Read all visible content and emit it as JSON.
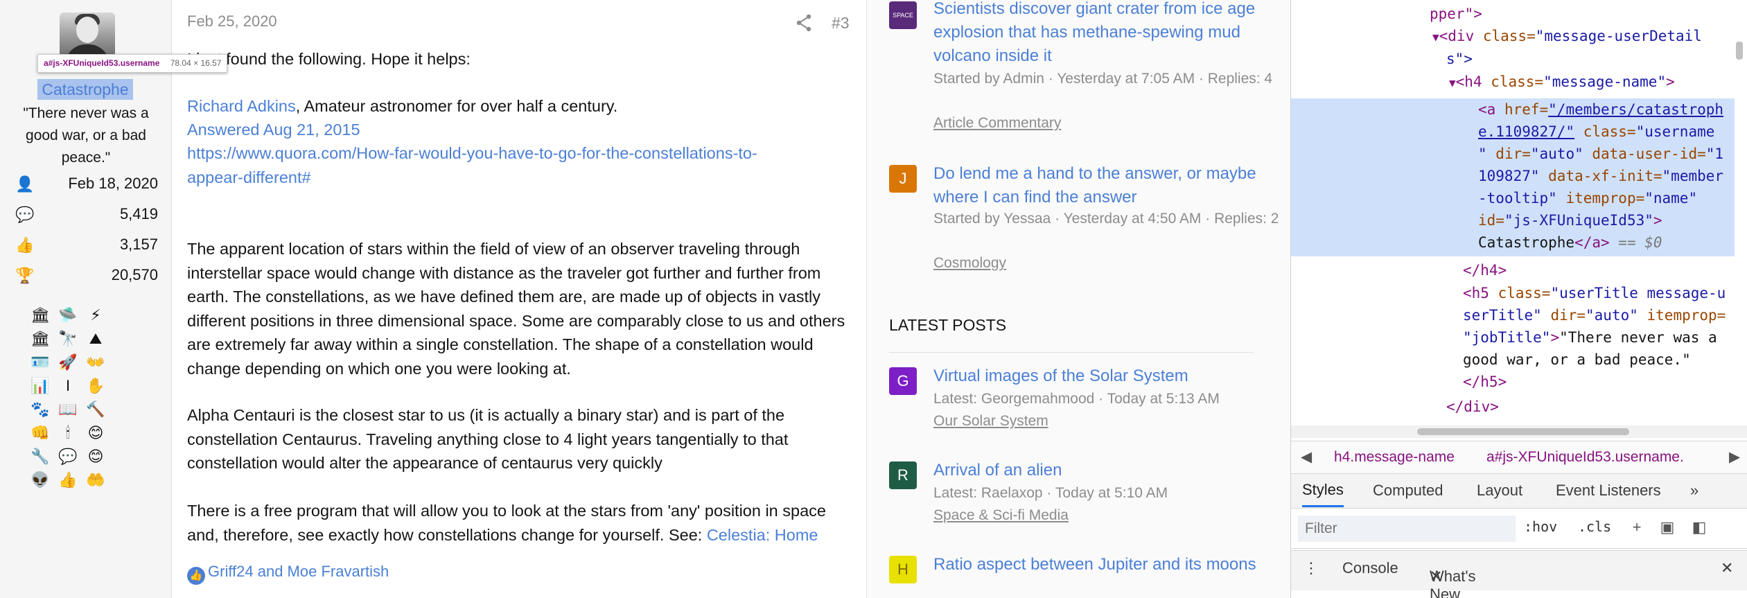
{
  "user": {
    "tooltip_selector": "a#js-XFUniqueId53.username",
    "tooltip_dims": "78.04 × 16.57",
    "username": "Catastrophe",
    "title": "\"There never was a good war, or a bad peace.\"",
    "stats": [
      {
        "icon": "user-icon",
        "glyph": "👤",
        "value": "Feb 18, 2020"
      },
      {
        "icon": "messages-icon",
        "glyph": "💬",
        "value": "5,419"
      },
      {
        "icon": "thumbs-up-icon",
        "glyph": "👍",
        "value": "3,157"
      },
      {
        "icon": "trophy-icon",
        "glyph": "🏆",
        "value": "20,570"
      }
    ],
    "trophies": [
      "🏛",
      "🛸",
      "⚡",
      "🏛",
      "🔭",
      "⛰",
      "🪪",
      "🚀",
      "👐",
      "📊",
      "I",
      "✋",
      "🐾",
      "📖",
      "🔨",
      "👊",
      "🕯",
      "😊",
      "🔧",
      "💬",
      "😊",
      "👽",
      "👍",
      "🤲"
    ]
  },
  "post": {
    "date": "Feb 25, 2020",
    "number": "#3",
    "intro": "I just found the following. Hope it helps:",
    "author_link": "Richard Adkins",
    "author_desc": ", Amateur astronomer for over half a century.",
    "answered": "Answered Aug 21, 2015",
    "url_line1": "https://www.quora.com/How-far-would-you-have-to-go-for-the-constellations-to-",
    "url_line2": "appear-different#",
    "para1": "The apparent location of stars within the field of view of an observer traveling through interstellar space would change with distance as the traveler got further and further from earth. The constellations, as we have defined them are, are made up of objects in vastly different positions in three dimensional space. Some are comparably close to us and others are extremely far away within a single constellation. The shape of a constellation would change depending on which one you were looking at.",
    "para2": "Alpha Centauri is the closest star to us (it is actually a binary star) and is part of the constellation Centaurus. Traveling anything close to 4 light years tangentially to that constellation would alter the appearance of centaurus very quickly",
    "para3": "There is a free program that will allow you to look at the stars from 'any' position in space and, therefore, see exactly how constellations change for yourself. See: ",
    "para3_link": "Celestia: Home",
    "reactions": "Griff24 and Moe Fravartish"
  },
  "widgets": {
    "threads": [
      {
        "avatar": "SPACE",
        "avatar_color": "#5a2a7a",
        "title": "Scientists discover giant crater from ice age explosion that has methane-spewing mud volcano inside it",
        "meta": "Started by Admin · Yesterday at 7:05 AM · Replies: 4",
        "forum": "Article Commentary"
      },
      {
        "avatar": "J",
        "avatar_color": "#d97706",
        "title": "Do lend me a hand to the answer, or maybe where I can find the answer",
        "meta": "Started by Yessaa · Yesterday at 4:50 AM · Replies: 2",
        "forum": "Cosmology"
      }
    ],
    "latest_heading": "LATEST POSTS",
    "latest": [
      {
        "avatar": "G",
        "avatar_color": "#7c1fc7",
        "title": "Virtual images of the Solar System",
        "meta": "Latest: Georgemahmood · Today at 5:13 AM",
        "forum": "Our Solar System"
      },
      {
        "avatar": "R",
        "avatar_color": "#1f5c46",
        "title": "Arrival of an alien",
        "meta": "Latest: Raelaxop · Today at 5:10 AM",
        "forum": "Space & Sci-fi Media"
      },
      {
        "avatar": "H",
        "avatar_color": "#e8e000",
        "title": "Ratio aspect between Jupiter and its moons",
        "meta": "",
        "forum": ""
      }
    ]
  },
  "devtools": {
    "dom": {
      "l1": "pper\">",
      "l2_tag": "<div ",
      "l2_attr": "class=",
      "l2_val": "\"message-userDetail",
      "l3": "s\">",
      "l4_tag": "<h4 ",
      "l4_attr": "class=",
      "l4_val": "\"message-name\"",
      "l4_end": ">",
      "l5_tag": "<a ",
      "l5_attr": "href=",
      "l5_val": "\"/members/catastroph",
      "l6_val": "e.1109827/\"",
      "l6_attr": " class=",
      "l6_val2": "\"username",
      "l7_val": "\"",
      "l7_attr": " dir=",
      "l7_val2": "\"auto\"",
      "l7_attr2": " data-user-id=",
      "l7_val3": "\"1",
      "l8_val": "109827\"",
      "l8_attr": " data-xf-init=",
      "l8_val2": "\"member",
      "l9_val": "-tooltip\"",
      "l9_attr": " itemprop=",
      "l9_val2": "\"name\"",
      "l10_attr": "id=",
      "l10_val": "\"js-XFUniqueId53\"",
      "l10_end": ">",
      "l11_text": "Catastrophe",
      "l11_tag": "</a>",
      "l11_eq": " == $0",
      "l12": "</h4>",
      "l13_tag": "<h5 ",
      "l13_attr": "class=",
      "l13_val": "\"userTitle message-u",
      "l14_val": "serTitle\"",
      "l14_attr": " dir=",
      "l14_val2": "\"auto\"",
      "l14_attr2": " itemprop=",
      "l15_val": "\"jobTitle\"",
      "l15_end": ">",
      "l15_text": "\"There never was a",
      "l16_text": "good war, or a bad peace.\"",
      "l17": "</h5>",
      "l18": "</div>"
    },
    "crumbs": [
      "h4.message-name",
      "a#js-XFUniqueId53.username."
    ],
    "tabs": [
      "Styles",
      "Computed",
      "Layout",
      "Event Listeners",
      "»"
    ],
    "filter_placeholder": "Filter",
    "hov": ":hov",
    "cls": ".cls",
    "drawer_tabs": [
      "Console",
      "What's New"
    ]
  }
}
